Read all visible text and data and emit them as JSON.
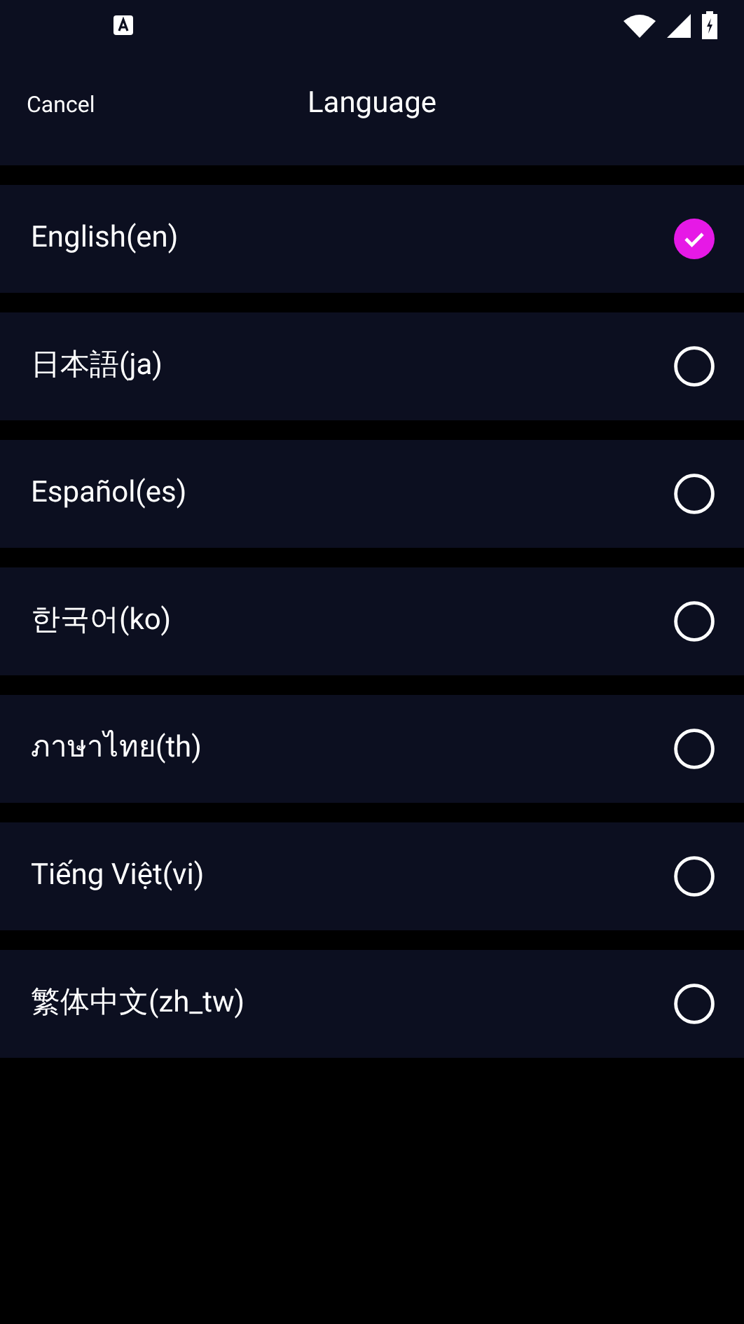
{
  "header": {
    "cancel": "Cancel",
    "title": "Language"
  },
  "languages": [
    {
      "label": "English(en)",
      "selected": true
    },
    {
      "label": "日本語(ja)",
      "selected": false
    },
    {
      "label": "Español(es)",
      "selected": false
    },
    {
      "label": "한국어(ko)",
      "selected": false
    },
    {
      "label": "ภาษาไทย(th)",
      "selected": false
    },
    {
      "label": "Tiếng Việt(vi)",
      "selected": false
    },
    {
      "label": "繁体中文(zh_tw)",
      "selected": false
    }
  ]
}
